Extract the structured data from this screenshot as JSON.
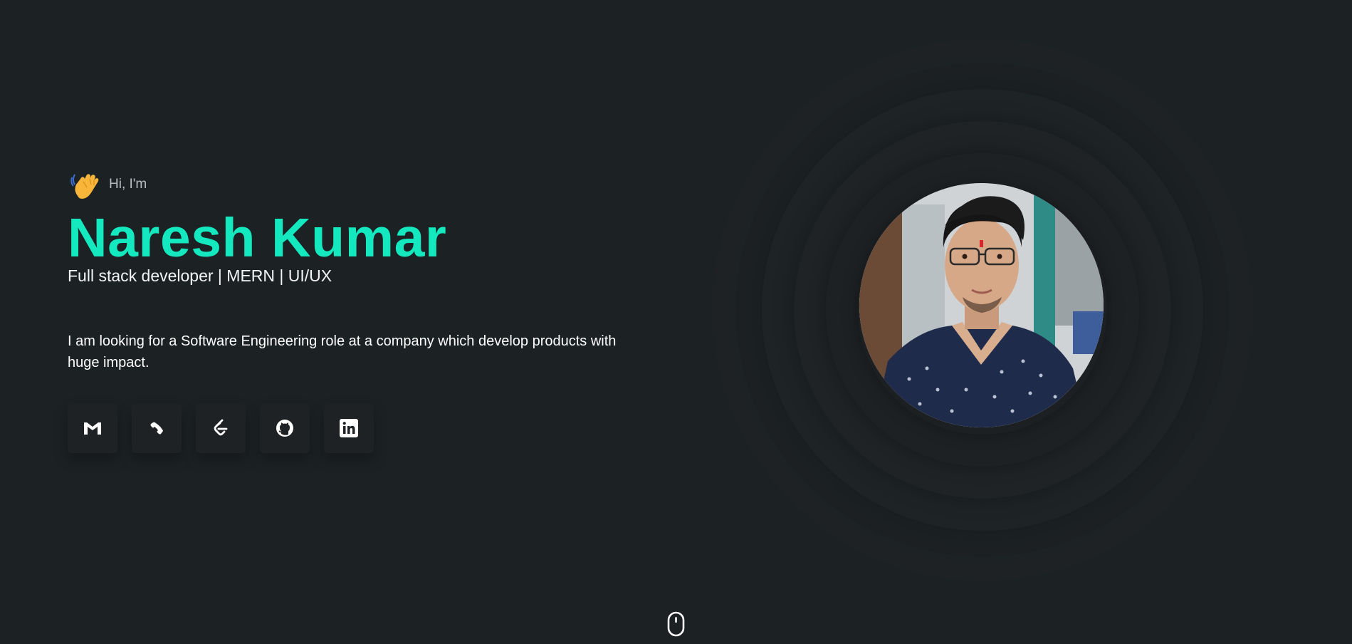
{
  "hero": {
    "greeting": "Hi, I'm",
    "name": "Naresh Kumar",
    "role": "Full stack developer | MERN | UI/UX",
    "bio": "I am looking for a Software Engineering role at a company which develop products with huge impact."
  },
  "socials": [
    {
      "icon": "gmail-icon"
    },
    {
      "icon": "phone-icon"
    },
    {
      "icon": "leetcode-icon"
    },
    {
      "icon": "github-icon"
    },
    {
      "icon": "linkedin-icon"
    }
  ],
  "colors": {
    "background": "#1c2124",
    "accent": "#14e8bf",
    "text": "#ffffff",
    "muted": "#b9bec2"
  },
  "icons": {
    "wave": "waving-hand-icon",
    "scroll": "mouse-scroll-icon"
  }
}
